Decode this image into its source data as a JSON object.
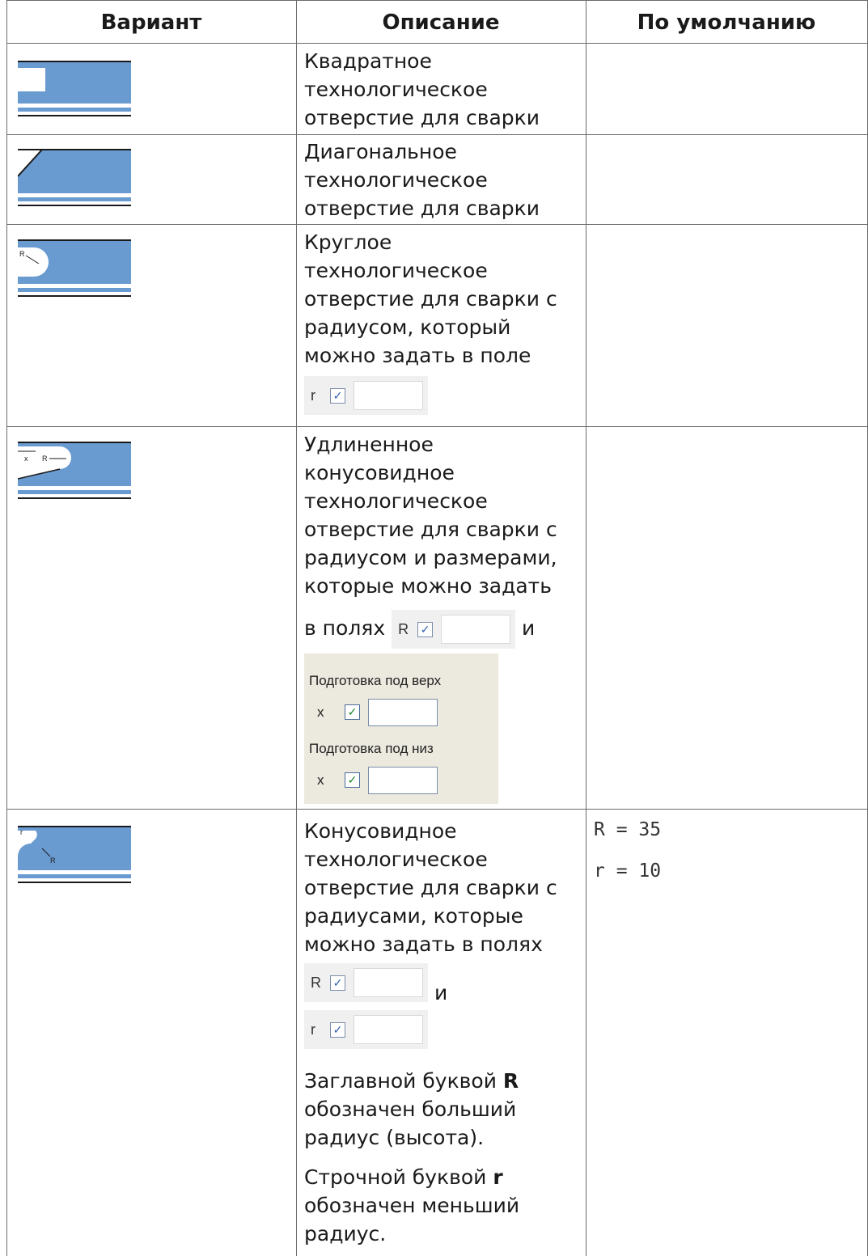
{
  "headers": {
    "variant": "Вариант",
    "description": "Описание",
    "default": "По умолчанию"
  },
  "rows": [
    {
      "icon": "square-weld-hole-icon",
      "description": "Квадратное технологическое отверстие для сварки"
    },
    {
      "icon": "diagonal-weld-hole-icon",
      "description": "Диагональное технологическое отверстие для сварки"
    },
    {
      "icon": "round-weld-hole-icon",
      "description": "Круглое технологическое отверстие для сварки с радиусом, который можно задать в поле",
      "icon_labels": [
        "R"
      ],
      "field": {
        "label": "r"
      }
    },
    {
      "icon": "elongated-cone-weld-hole-icon",
      "description": "Удлиненное конусовидное технологическое отверстие для сварки с радиусом и размерами, которые можно задать",
      "in_fields": "в полях",
      "and": "и",
      "icon_labels": [
        "x",
        "R"
      ],
      "field": {
        "label": "R"
      },
      "panel": {
        "top_title": "Подготовка под верх",
        "top_label": "x",
        "bottom_title": "Подготовка под низ",
        "bottom_label": "x"
      }
    },
    {
      "icon": "cone-weld-hole-icon",
      "description": "Конусовидное технологическое отверстие для сварки с радиусами, которые можно задать в полях",
      "icon_labels": [
        "r",
        "R"
      ],
      "field_big": {
        "label": "R"
      },
      "and": "и",
      "field_small": {
        "label": "r"
      },
      "note1_pre": "Заглавной буквой ",
      "note1_bold": "R",
      "note1_post": " обозначен больший радиус (высота).",
      "note2_pre": "Строчной буквой ",
      "note2_bold": "r",
      "note2_post": " обозначен меньший радиус.",
      "defaults": [
        "R = 35",
        "r = 10"
      ]
    }
  ],
  "colors": {
    "plate": "#6a9bd0",
    "line": "#1a1a1a",
    "grid": "#6b6b6b"
  }
}
